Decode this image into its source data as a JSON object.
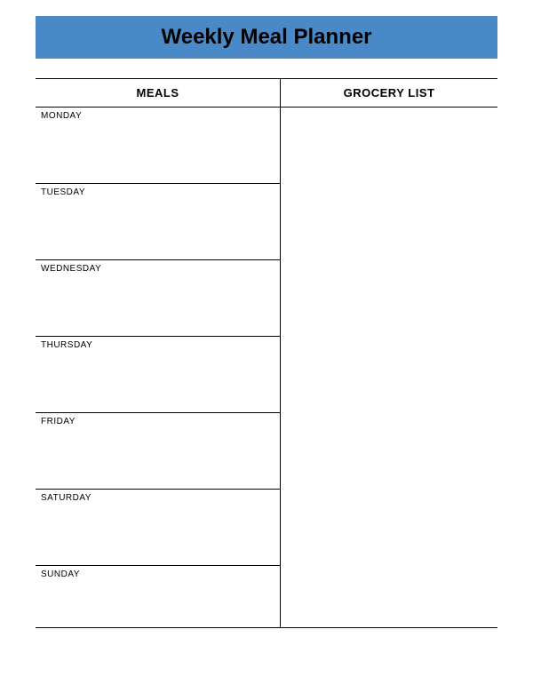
{
  "title": "Weekly Meal Planner",
  "columns": {
    "meals": "MEALS",
    "grocery": "GROCERY LIST"
  },
  "days": [
    {
      "label": "MONDAY"
    },
    {
      "label": "TUESDAY"
    },
    {
      "label": "WEDNESDAY"
    },
    {
      "label": "THURSDAY"
    },
    {
      "label": "FRIDAY"
    },
    {
      "label": "SATURDAY"
    },
    {
      "label": "SUNDAY"
    }
  ],
  "colors": {
    "banner": "#4a89c7"
  }
}
